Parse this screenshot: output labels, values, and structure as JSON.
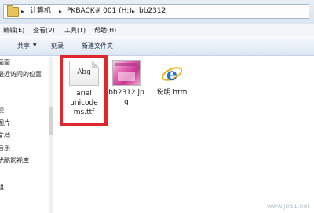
{
  "address_bar": {
    "crumbs": [
      "计算机",
      "PKBACK# 001 (H:)",
      "bb2312"
    ]
  },
  "menu": [
    "编辑(E)",
    "查看(V)",
    "工具(T)",
    "帮助(H)"
  ],
  "toolbar": {
    "share_label": "共享",
    "burn_label": "刻录",
    "new_folder_label": "新建文件夹"
  },
  "nav": {
    "items": [
      "画面",
      "最近访问的位置",
      "视",
      "图片",
      "文档",
      "音乐",
      "优酷影视库",
      "组"
    ]
  },
  "files": [
    {
      "icon": "font-file-icon",
      "icon_text": "Abg",
      "name": "arial unicodems.ttf",
      "name_lines": [
        "arial",
        "unicode",
        "ms.ttf"
      ]
    },
    {
      "icon": "image-file-icon",
      "name": "bb2312.jpg",
      "name_lines": [
        "bb2312.jp",
        "g"
      ]
    },
    {
      "icon": "ie-html-icon",
      "name": "说明.htm",
      "name_lines": [
        "说明.htm"
      ]
    }
  ],
  "colors": {
    "highlight": "#e0272b",
    "toolbar": "#dce6f3"
  },
  "watermark": "www.jb51.net"
}
